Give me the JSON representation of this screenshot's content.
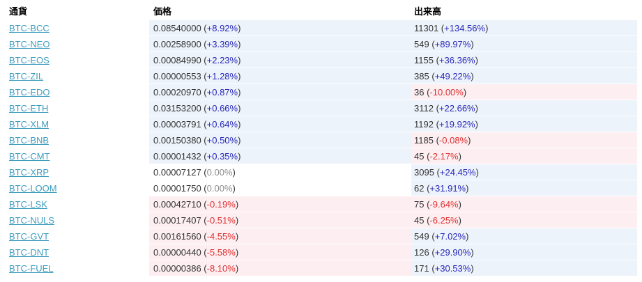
{
  "headers": {
    "currency": "通貨",
    "price": "価格",
    "volume": "出来高"
  },
  "rows": [
    {
      "pair": "BTC-BCC",
      "price": "0.08540000",
      "price_change": "+8.92%",
      "price_dir": "up",
      "volume": "11301",
      "volume_change": "+134.56%",
      "volume_dir": "up"
    },
    {
      "pair": "BTC-NEO",
      "price": "0.00258900",
      "price_change": "+3.39%",
      "price_dir": "up",
      "volume": "549",
      "volume_change": "+89.97%",
      "volume_dir": "up"
    },
    {
      "pair": "BTC-EOS",
      "price": "0.00084990",
      "price_change": "+2.23%",
      "price_dir": "up",
      "volume": "1155",
      "volume_change": "+36.36%",
      "volume_dir": "up"
    },
    {
      "pair": "BTC-ZIL",
      "price": "0.00000553",
      "price_change": "+1.28%",
      "price_dir": "up",
      "volume": "385",
      "volume_change": "+49.22%",
      "volume_dir": "up"
    },
    {
      "pair": "BTC-EDO",
      "price": "0.00020970",
      "price_change": "+0.87%",
      "price_dir": "up",
      "volume": "36",
      "volume_change": "-10.00%",
      "volume_dir": "down"
    },
    {
      "pair": "BTC-ETH",
      "price": "0.03153200",
      "price_change": "+0.66%",
      "price_dir": "up",
      "volume": "3112",
      "volume_change": "+22.66%",
      "volume_dir": "up"
    },
    {
      "pair": "BTC-XLM",
      "price": "0.00003791",
      "price_change": "+0.64%",
      "price_dir": "up",
      "volume": "1192",
      "volume_change": "+19.92%",
      "volume_dir": "up"
    },
    {
      "pair": "BTC-BNB",
      "price": "0.00150380",
      "price_change": "+0.50%",
      "price_dir": "up",
      "volume": "1185",
      "volume_change": "-0.08%",
      "volume_dir": "down"
    },
    {
      "pair": "BTC-CMT",
      "price": "0.00001432",
      "price_change": "+0.35%",
      "price_dir": "up",
      "volume": "45",
      "volume_change": "-2.17%",
      "volume_dir": "down"
    },
    {
      "pair": "BTC-XRP",
      "price": "0.00007127",
      "price_change": "0.00%",
      "price_dir": "flat",
      "volume": "3095",
      "volume_change": "+24.45%",
      "volume_dir": "up"
    },
    {
      "pair": "BTC-LOOM",
      "price": "0.00001750",
      "price_change": "0.00%",
      "price_dir": "flat",
      "volume": "62",
      "volume_change": "+31.91%",
      "volume_dir": "up"
    },
    {
      "pair": "BTC-LSK",
      "price": "0.00042710",
      "price_change": "-0.19%",
      "price_dir": "down",
      "volume": "75",
      "volume_change": "-9.64%",
      "volume_dir": "down"
    },
    {
      "pair": "BTC-NULS",
      "price": "0.00017407",
      "price_change": "-0.51%",
      "price_dir": "down",
      "volume": "45",
      "volume_change": "-6.25%",
      "volume_dir": "down"
    },
    {
      "pair": "BTC-GVT",
      "price": "0.00161560",
      "price_change": "-4.55%",
      "price_dir": "down",
      "volume": "549",
      "volume_change": "+7.02%",
      "volume_dir": "up"
    },
    {
      "pair": "BTC-DNT",
      "price": "0.00000440",
      "price_change": "-5.58%",
      "price_dir": "down",
      "volume": "126",
      "volume_change": "+29.90%",
      "volume_dir": "up"
    },
    {
      "pair": "BTC-FUEL",
      "price": "0.00000386",
      "price_change": "-8.10%",
      "price_dir": "down",
      "volume": "171",
      "volume_change": "+30.53%",
      "volume_dir": "up"
    }
  ],
  "colors": {
    "link": "#3d9dbd",
    "up_text": "#2727b8",
    "down_text": "#e03030",
    "flat_text": "#8c8c8c",
    "up_bg": "#edf3fb",
    "down_bg": "#fdeef1"
  }
}
